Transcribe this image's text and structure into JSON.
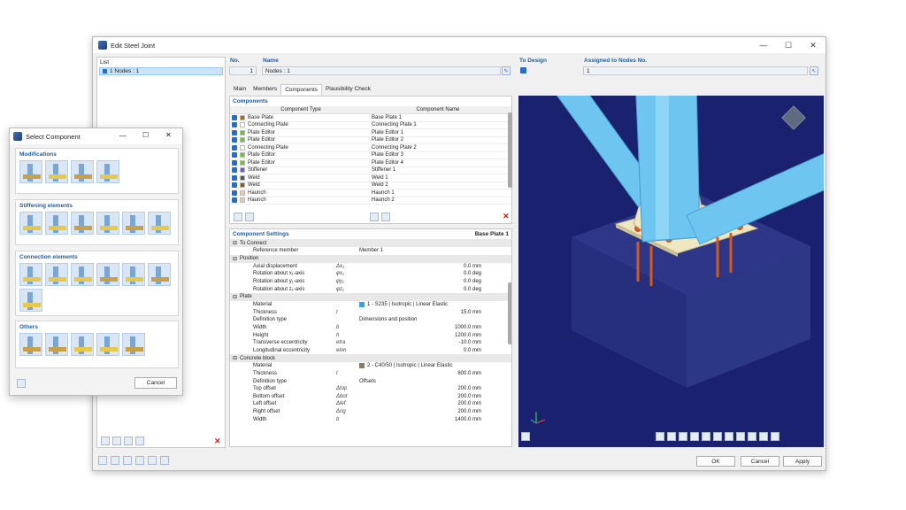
{
  "window": {
    "title": "Edit Steel Joint"
  },
  "list": {
    "header": "List",
    "items": [
      "1  Nodes : 1"
    ]
  },
  "fields": {
    "no_label": "No.",
    "no_value": "1",
    "name_label": "Name",
    "name_value": "Nodes : 1",
    "to_design_label": "To Design",
    "assigned_label": "Assigned to Nodes No.",
    "assigned_value": "1"
  },
  "tabs": [
    "Main",
    "Members",
    "Components",
    "Plausibility Check"
  ],
  "components": {
    "title": "Components",
    "col_type": "Component Type",
    "col_name": "Component Name",
    "rows": [
      {
        "type": "Base Plate",
        "name": "Base Plate 1",
        "color": "#b5651d"
      },
      {
        "type": "Connecting Plate",
        "name": "Connecting Plate 1",
        "color": "#ffffff"
      },
      {
        "type": "Plate Editor",
        "name": "Plate Editor 1",
        "color": "#6fbf3a"
      },
      {
        "type": "Plate Editor",
        "name": "Plate Editor 2",
        "color": "#6fbf3a"
      },
      {
        "type": "Connecting Plate",
        "name": "Connecting Plate 2",
        "color": "#ffffff"
      },
      {
        "type": "Plate Editor",
        "name": "Plate Editor 3",
        "color": "#6fbf3a"
      },
      {
        "type": "Plate Editor",
        "name": "Plate Editor 4",
        "color": "#6fbf3a"
      },
      {
        "type": "Stiffener",
        "name": "Stiffener 1",
        "color": "#6a5acd"
      },
      {
        "type": "Weld",
        "name": "Weld 1",
        "color": "#555555"
      },
      {
        "type": "Weld",
        "name": "Weld 2",
        "color": "#8b5a2b"
      },
      {
        "type": "Haunch",
        "name": "Haunch 1",
        "color": "#e8c8a8"
      },
      {
        "type": "Haunch",
        "name": "Haunch 2",
        "color": "#e8c8a8"
      }
    ]
  },
  "settings": {
    "title": "Component Settings",
    "subject": "Base Plate 1",
    "sections": [
      {
        "name": "To Connect",
        "rows": [
          {
            "n": "Reference member",
            "s": "",
            "v": "Member 1"
          }
        ]
      },
      {
        "name": "Position",
        "rows": [
          {
            "n": "Axial displacement",
            "s": "Δx₁",
            "v": "0.0 mm"
          },
          {
            "n": "Rotation about x₁-axis",
            "s": "φx₁",
            "v": "0.0 deg"
          },
          {
            "n": "Rotation about y₁-axis",
            "s": "φy₁",
            "v": "0.0 deg"
          },
          {
            "n": "Rotation about z₁-axis",
            "s": "φz₁",
            "v": "0.0 deg"
          }
        ]
      },
      {
        "name": "Plate",
        "rows": [
          {
            "n": "Material",
            "s": "",
            "v": "1 - S235 | Isotropic | Linear Elastic"
          },
          {
            "n": "Thickness",
            "s": "t",
            "v": "15.0 mm"
          },
          {
            "n": "Definition type",
            "s": "",
            "v": "Dimensions and position"
          },
          {
            "n": "Width",
            "s": "b",
            "v": "1000.0 mm"
          },
          {
            "n": "Height",
            "s": "h",
            "v": "1200.0 mm"
          },
          {
            "n": "Transverse eccentricity",
            "s": "etra",
            "v": "-10.0 mm"
          },
          {
            "n": "Longitudinal eccentricity",
            "s": "elon",
            "v": "0.0 mm"
          }
        ]
      },
      {
        "name": "Concrete block",
        "rows": [
          {
            "n": "Material",
            "s": "",
            "v": "2 - C40/50 | Isotropic | Linear Elastic"
          },
          {
            "n": "Thickness",
            "s": "t",
            "v": "800.0 mm"
          },
          {
            "n": "Definition type",
            "s": "",
            "v": "Offsets"
          },
          {
            "n": "Top offset",
            "s": "Δtop",
            "v": "200.0 mm"
          },
          {
            "n": "Bottom offset",
            "s": "Δbot",
            "v": "200.0 mm"
          },
          {
            "n": "Left offset",
            "s": "Δlef",
            "v": "200.0 mm"
          },
          {
            "n": "Right offset",
            "s": "Δrig",
            "v": "200.0 mm"
          },
          {
            "n": "Width",
            "s": "b",
            "v": "1400.0 mm"
          }
        ]
      }
    ]
  },
  "buttons": {
    "ok": "OK",
    "cancel": "Cancel",
    "apply": "Apply"
  },
  "select_dialog": {
    "title": "Select Component",
    "groups": [
      "Modifications",
      "Stiffening elements",
      "Connection elements",
      "Others"
    ],
    "cancel": "Cancel"
  },
  "colors": {
    "viewport": "#1a2270",
    "member": "#6ec6f0",
    "plate": "#efe6c2",
    "bolt": "#d35a1f"
  }
}
